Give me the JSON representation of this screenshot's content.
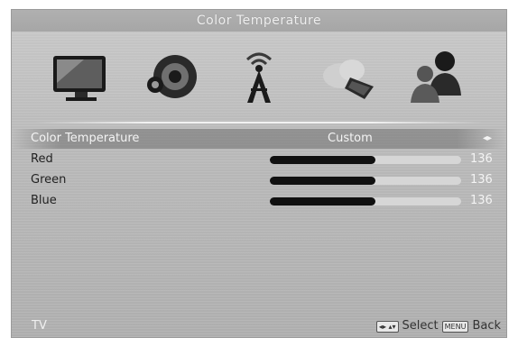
{
  "title": "Color Temperature",
  "menu_icons": [
    {
      "name": "picture-icon"
    },
    {
      "name": "sound-icon"
    },
    {
      "name": "channel-antenna-icon"
    },
    {
      "name": "network-icon"
    },
    {
      "name": "users-icon"
    }
  ],
  "settings": {
    "color_temperature": {
      "label": "Color Temperature",
      "value": "Custom",
      "arrows": "◂▸"
    },
    "red": {
      "label": "Red",
      "value": "136",
      "level": 0.55
    },
    "green": {
      "label": "Green",
      "value": "136",
      "level": 0.55
    },
    "blue": {
      "label": "Blue",
      "value": "136",
      "level": 0.55
    }
  },
  "footer": {
    "source": "TV",
    "keys": "◂▸ ▴▾",
    "select_label": "Select",
    "menu_key": "MENU",
    "back_label": "Back"
  }
}
